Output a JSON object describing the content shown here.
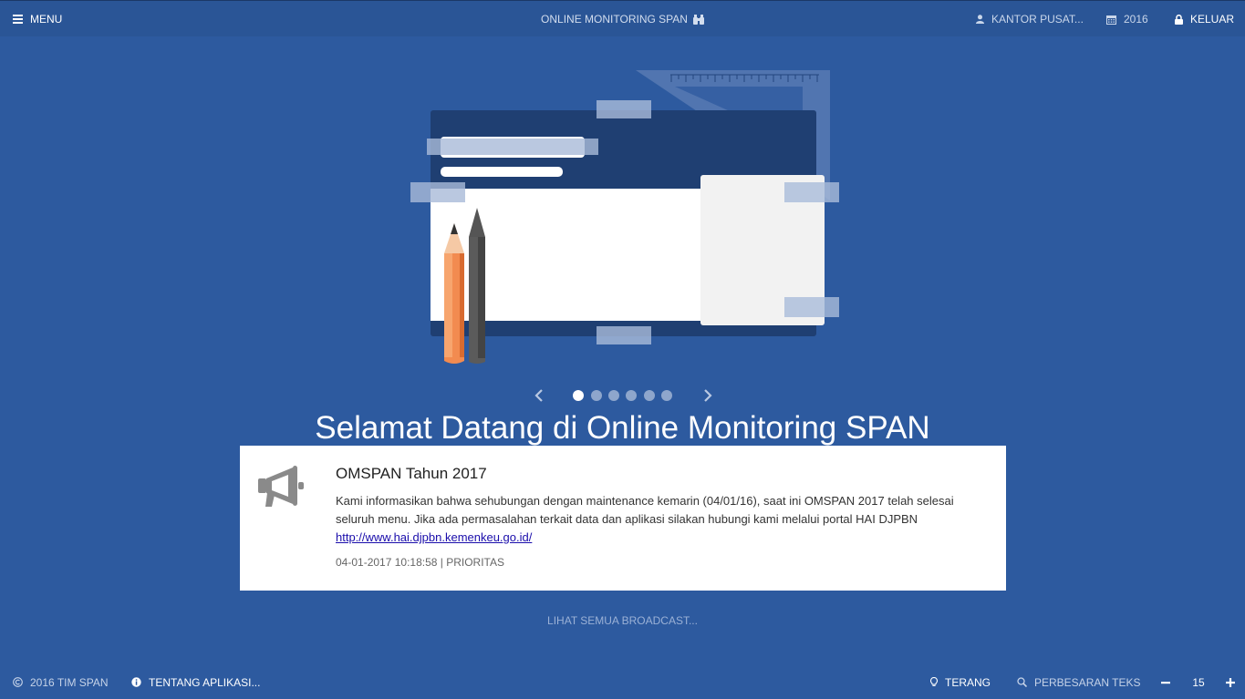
{
  "header": {
    "menu_label": "MENU",
    "app_title": "ONLINE MONITORING SPAN",
    "office_label": "KANTOR PUSAT...",
    "year_label": "2016",
    "logout_label": "KELUAR"
  },
  "carousel": {
    "slide_count": 6,
    "active_index": 0
  },
  "welcome_text": "Selamat Datang di Online Monitoring SPAN",
  "broadcast": {
    "title": "OMSPAN Tahun 2017",
    "body": "Kami informasikan bahwa sehubungan dengan maintenance kemarin (04/01/16), saat ini OMSPAN 2017 telah selesai seluruh menu. Jika ada permasalahan terkait data dan aplikasi silakan hubungi kami melalui portal HAI DJPBN",
    "link_text": "http://www.hai.djpbn.kemenkeu.go.id/",
    "meta": "04-01-2017 10:18:58 | PRIORITAS"
  },
  "see_all_label": "LIHAT SEMUA BROADCAST...",
  "footer": {
    "copyright": "2016 TIM SPAN",
    "about_label": "TENTANG APLIKASI...",
    "theme_label": "TERANG",
    "zoom_label": "PERBESARAN TEKS",
    "font_size": "15"
  },
  "colors": {
    "background": "#2d5a9f",
    "topbar": "#2a5596",
    "card": "#ffffff",
    "link": "#1a0dab"
  }
}
